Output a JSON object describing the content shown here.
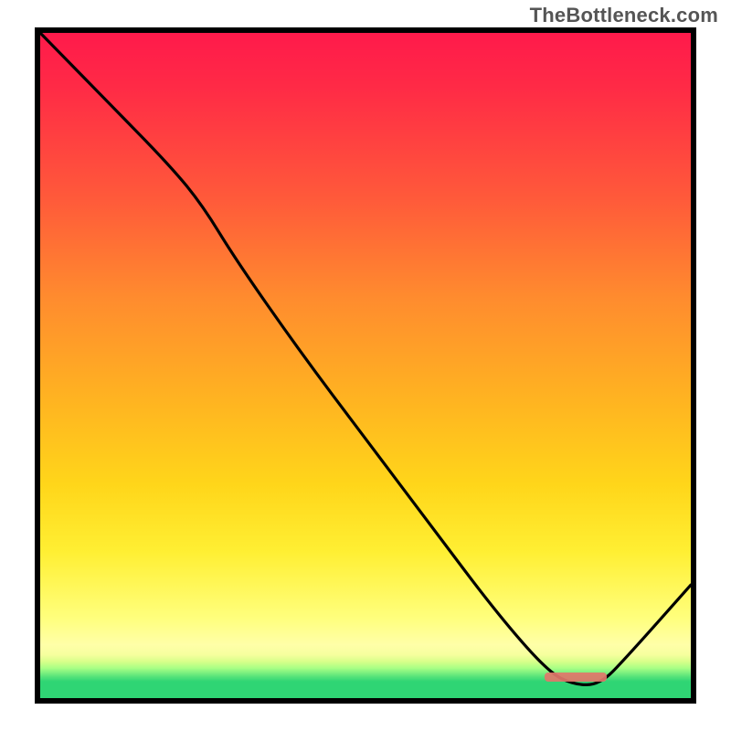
{
  "watermark": "TheBottleneck.com",
  "colors": {
    "frame": "#000000",
    "gradient_top": "#ff1a4b",
    "gradient_mid1": "#ff8c2e",
    "gradient_mid2": "#ffff7d",
    "gradient_bottom": "#2fd574",
    "curve": "#000000",
    "marker": "#e2766a"
  },
  "chart_data": {
    "type": "line",
    "title": "",
    "xlabel": "",
    "ylabel": "",
    "xlim": [
      0,
      1
    ],
    "ylim": [
      0,
      1
    ],
    "note": "Axes are unlabeled in the image; values below are normalized estimates read from the plot area (0 = left/bottom, 1 = right/top).",
    "x": [
      0.0,
      0.1,
      0.2,
      0.25,
      0.3,
      0.4,
      0.5,
      0.6,
      0.7,
      0.78,
      0.82,
      0.86,
      0.9,
      1.0
    ],
    "y": [
      1.0,
      0.9,
      0.8,
      0.74,
      0.66,
      0.52,
      0.39,
      0.26,
      0.13,
      0.04,
      0.02,
      0.02,
      0.06,
      0.17
    ],
    "annotations": [
      {
        "kind": "min-marker",
        "x_range": [
          0.78,
          0.87
        ],
        "y": 0.02
      }
    ]
  }
}
